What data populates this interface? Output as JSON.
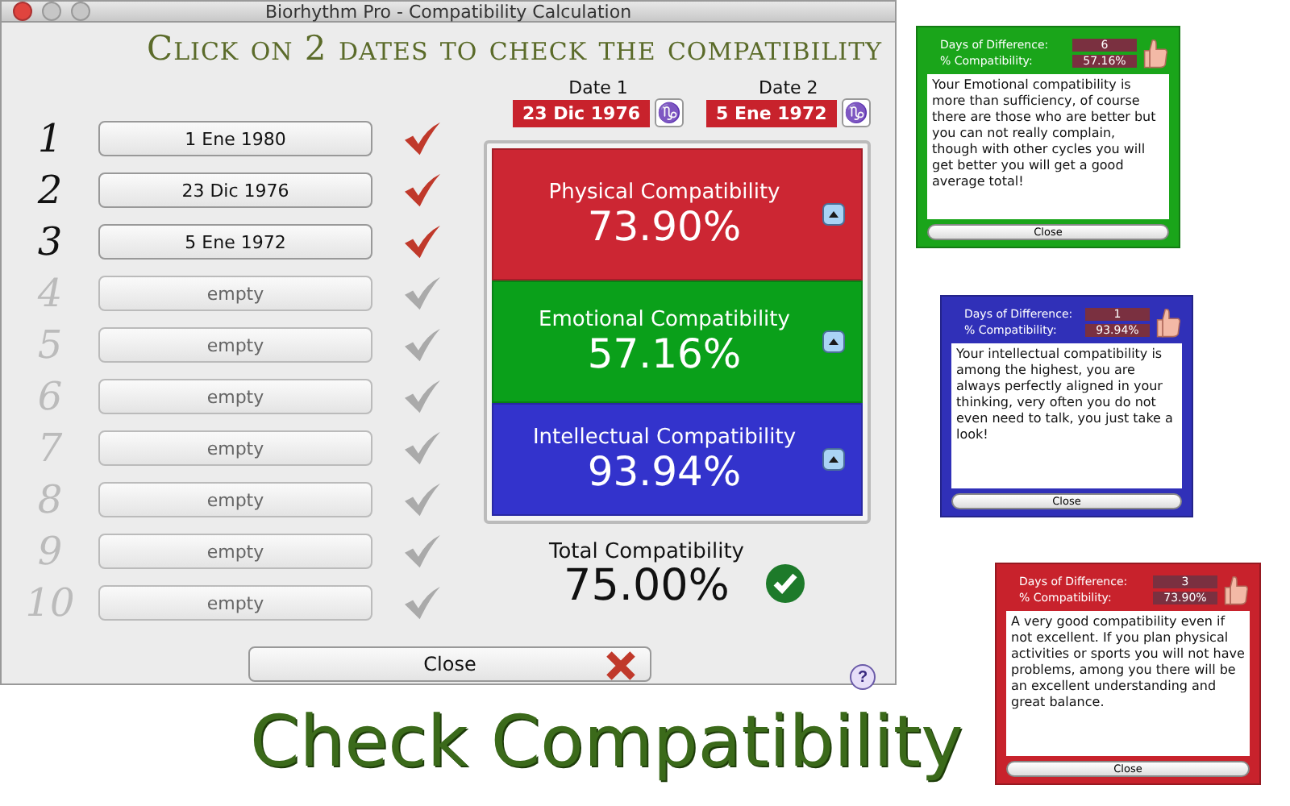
{
  "window": {
    "title": "Biorhythm Pro - Compatibility Calculation"
  },
  "heading": "Click on 2 dates to check the compatibility",
  "slots": [
    {
      "number": "1",
      "label": "1 Ene 1980",
      "checked": true
    },
    {
      "number": "2",
      "label": "23 Dic 1976",
      "checked": true
    },
    {
      "number": "3",
      "label": "5 Ene 1972",
      "checked": true
    },
    {
      "number": "4",
      "label": "empty",
      "checked": false
    },
    {
      "number": "5",
      "label": "empty",
      "checked": false
    },
    {
      "number": "6",
      "label": "empty",
      "checked": false
    },
    {
      "number": "7",
      "label": "empty",
      "checked": false
    },
    {
      "number": "8",
      "label": "empty",
      "checked": false
    },
    {
      "number": "9",
      "label": "empty",
      "checked": false
    },
    {
      "number": "10",
      "label": "empty",
      "checked": false
    }
  ],
  "dates": [
    {
      "label": "Date 1",
      "value": "23 Dic 1976",
      "sign": "♑"
    },
    {
      "label": "Date 2",
      "value": "5 Ene 1972",
      "sign": "♑"
    }
  ],
  "results": [
    {
      "title": "Physical Compatibility",
      "value": "73.90%",
      "color": "#cc2633"
    },
    {
      "title": "Emotional Compatibility",
      "value": "57.16%",
      "color": "#0aa01a"
    },
    {
      "title": "Intellectual Compatibility",
      "value": "93.94%",
      "color": "#3333cc"
    }
  ],
  "total": {
    "label": "Total Compatibility",
    "value": "75.00%"
  },
  "close_button": "Close",
  "help": "?",
  "dialogs": [
    {
      "color": "#1aa51a",
      "days_label": "Days of Difference:",
      "days": "6",
      "pct_label": "% Compatibility:",
      "pct": "57.16%",
      "text": "Your Emotional compatibility is more than sufficiency, of course there are those who are better but you can not really complain, though with other cycles you will get better you will get a good average total!",
      "close": "Close"
    },
    {
      "color": "#3030b8",
      "days_label": "Days of Difference:",
      "days": "1",
      "pct_label": "% Compatibility:",
      "pct": "93.94%",
      "text": "Your intellectual compatibility is among the highest, you are always perfectly aligned in your thinking, very often you do not even need to talk, you just take a look!",
      "close": "Close"
    },
    {
      "color": "#c8222c",
      "days_label": "Days of Difference:",
      "days": "3",
      "pct_label": "% Compatibility:",
      "pct": "73.90%",
      "text": "A very good compatibility even if not excellent. If you plan physical activities or sports you will not have problems, among you there will be an excellent understanding and great balance.",
      "close": "Close"
    }
  ],
  "caption": "Check Compatibility"
}
